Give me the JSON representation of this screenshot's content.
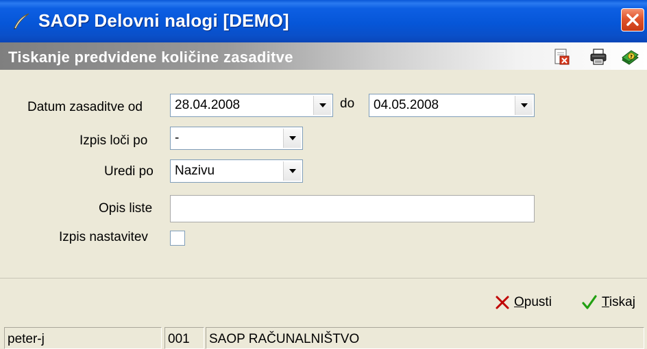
{
  "window": {
    "title": "SAOP Delovni nalogi [DEMO]"
  },
  "panel": {
    "title": "Tiskanje predvidene količine zasaditve",
    "toolbar_icons": [
      "close-document-icon",
      "printer-icon",
      "help-book-icon"
    ]
  },
  "form": {
    "date_from_label": "Datum zasaditve od",
    "date_from_value": "28.04.2008",
    "date_to_label": "do",
    "date_to_value": "04.05.2008",
    "split_label": "Izpis loči po",
    "split_value": "-",
    "sort_label": "Uredi po",
    "sort_value": "Nazivu",
    "description_label": "Opis liste",
    "description_value": "",
    "settings_label": "Izpis nastavitev",
    "settings_checked": false
  },
  "actions": {
    "cancel_accel": "O",
    "cancel_rest": "pusti",
    "print_accel": "T",
    "print_rest": "iskaj"
  },
  "status": {
    "user": "peter-j",
    "company_code": "001",
    "company_name": "SAOP RAČUNALNIŠTVO"
  },
  "colors": {
    "titlebar": "#0656d8",
    "close": "#e0542c",
    "cancel_icon": "#c00000",
    "print_icon": "#22a012"
  }
}
